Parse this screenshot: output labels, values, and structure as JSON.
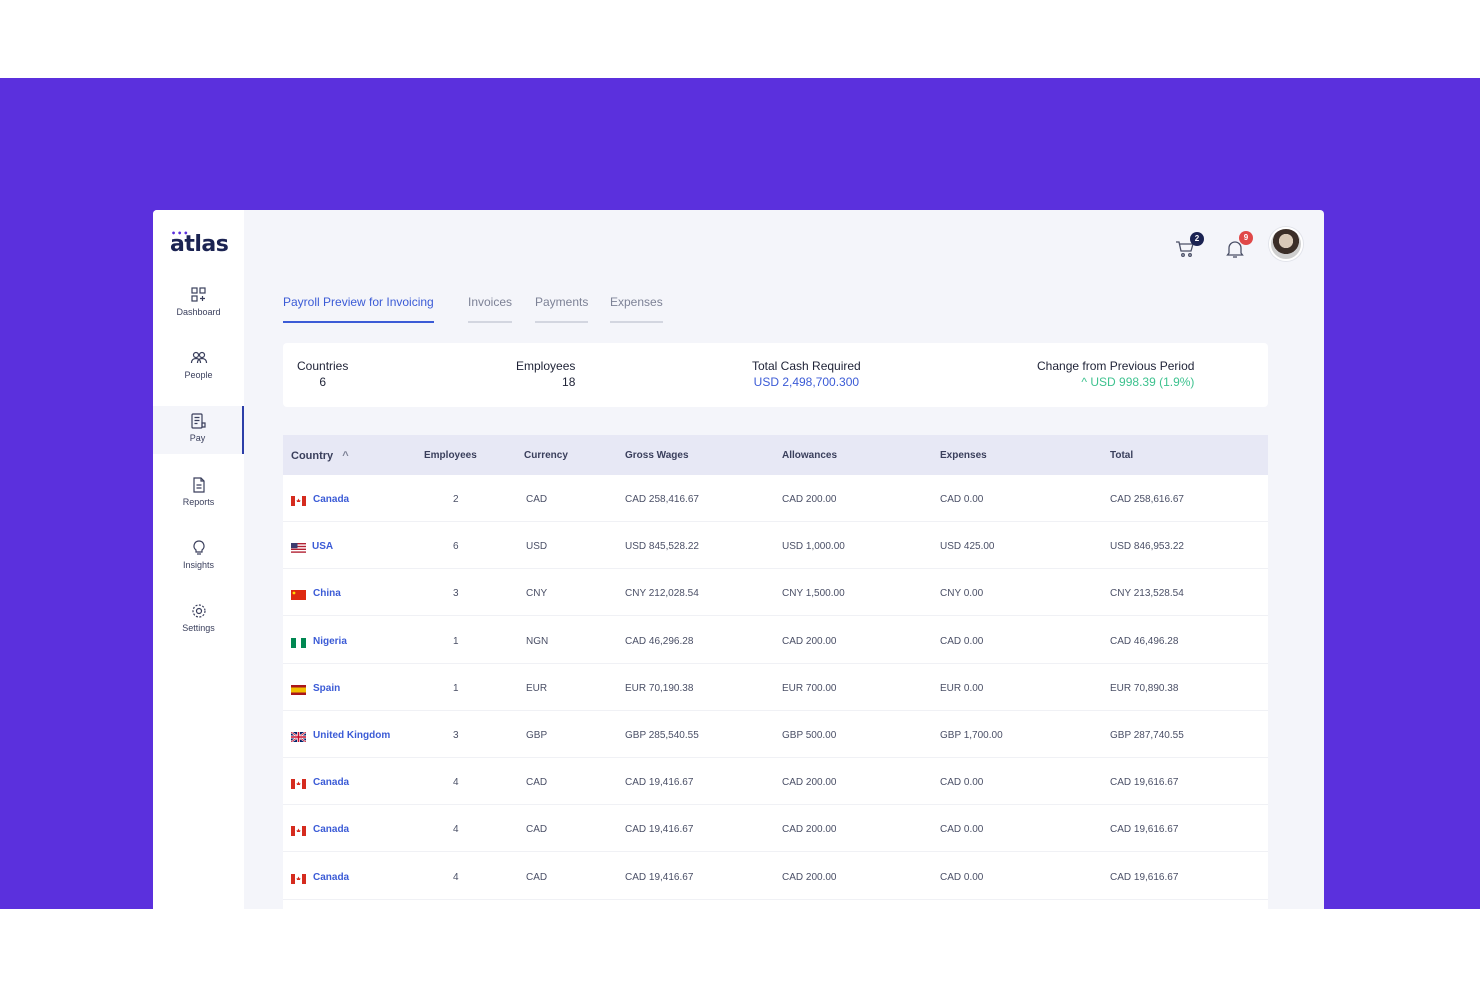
{
  "app": {
    "logo": "atlas",
    "logo_dots": "•••"
  },
  "sidebar": {
    "items": [
      {
        "label": "Dashboard",
        "icon": "dashboard-icon"
      },
      {
        "label": "People",
        "icon": "people-icon"
      },
      {
        "label": "Pay",
        "icon": "pay-icon"
      },
      {
        "label": "Reports",
        "icon": "reports-icon"
      },
      {
        "label": "Insights",
        "icon": "insights-icon"
      },
      {
        "label": "Settings",
        "icon": "settings-icon"
      }
    ]
  },
  "topbar": {
    "cart_count": "2",
    "notif_count": "9"
  },
  "tabs": [
    {
      "label": "Payroll Preview for Invoicing"
    },
    {
      "label": "Invoices"
    },
    {
      "label": "Payments"
    },
    {
      "label": "Expenses"
    }
  ],
  "summary": {
    "countries_label": "Countries",
    "countries_value": "6",
    "employees_label": "Employees",
    "employees_value": "18",
    "cash_label": "Total Cash Required",
    "cash_value": "USD 2,498,700.300",
    "change_label": "Change from Previous Period",
    "change_value": "^  USD 998.39 (1.9%)"
  },
  "table": {
    "headers": [
      "Country",
      "Employees",
      "Currency",
      "Gross Wages",
      "Allowances",
      "Expenses",
      "Total"
    ],
    "rows": [
      {
        "country": "Canada",
        "employees": "2",
        "currency": "CAD",
        "gross": "CAD 258,416.67",
        "allowances": "CAD 200.00",
        "expenses": "CAD 0.00",
        "total": "CAD 258,616.67"
      },
      {
        "country": "USA",
        "employees": "6",
        "currency": "USD",
        "gross": "USD 845,528.22",
        "allowances": "USD 1,000.00",
        "expenses": "USD 425.00",
        "total": "USD 846,953.22"
      },
      {
        "country": "China",
        "employees": "3",
        "currency": "CNY",
        "gross": "CNY 212,028.54",
        "allowances": "CNY 1,500.00",
        "expenses": "CNY 0.00",
        "total": "CNY 213,528.54"
      },
      {
        "country": "Nigeria",
        "employees": "1",
        "currency": "NGN",
        "gross": "CAD 46,296.28",
        "allowances": "CAD 200.00",
        "expenses": "CAD 0.00",
        "total": "CAD 46,496.28"
      },
      {
        "country": "Spain",
        "employees": "1",
        "currency": "EUR",
        "gross": "EUR 70,190.38",
        "allowances": "EUR 700.00",
        "expenses": "EUR 0.00",
        "total": "EUR 70,890.38"
      },
      {
        "country": "United Kingdom",
        "employees": "3",
        "currency": "GBP",
        "gross": "GBP 285,540.55",
        "allowances": "GBP 500.00",
        "expenses": "GBP 1,700.00",
        "total": "GBP 287,740.55"
      },
      {
        "country": "Canada",
        "employees": "4",
        "currency": "CAD",
        "gross": "CAD 19,416.67",
        "allowances": "CAD 200.00",
        "expenses": "CAD 0.00",
        "total": "CAD 19,616.67"
      },
      {
        "country": "Canada",
        "employees": "4",
        "currency": "CAD",
        "gross": "CAD 19,416.67",
        "allowances": "CAD 200.00",
        "expenses": "CAD 0.00",
        "total": "CAD 19,616.67"
      },
      {
        "country": "Canada",
        "employees": "4",
        "currency": "CAD",
        "gross": "CAD 19,416.67",
        "allowances": "CAD 200.00",
        "expenses": "CAD 0.00",
        "total": "CAD 19,616.67"
      }
    ]
  },
  "colors": {
    "background_band": "#5b30dd",
    "accent": "#3b5bd6",
    "positive": "#3ec28f",
    "badge_dark": "#1b2352",
    "badge_red": "#e04848"
  }
}
